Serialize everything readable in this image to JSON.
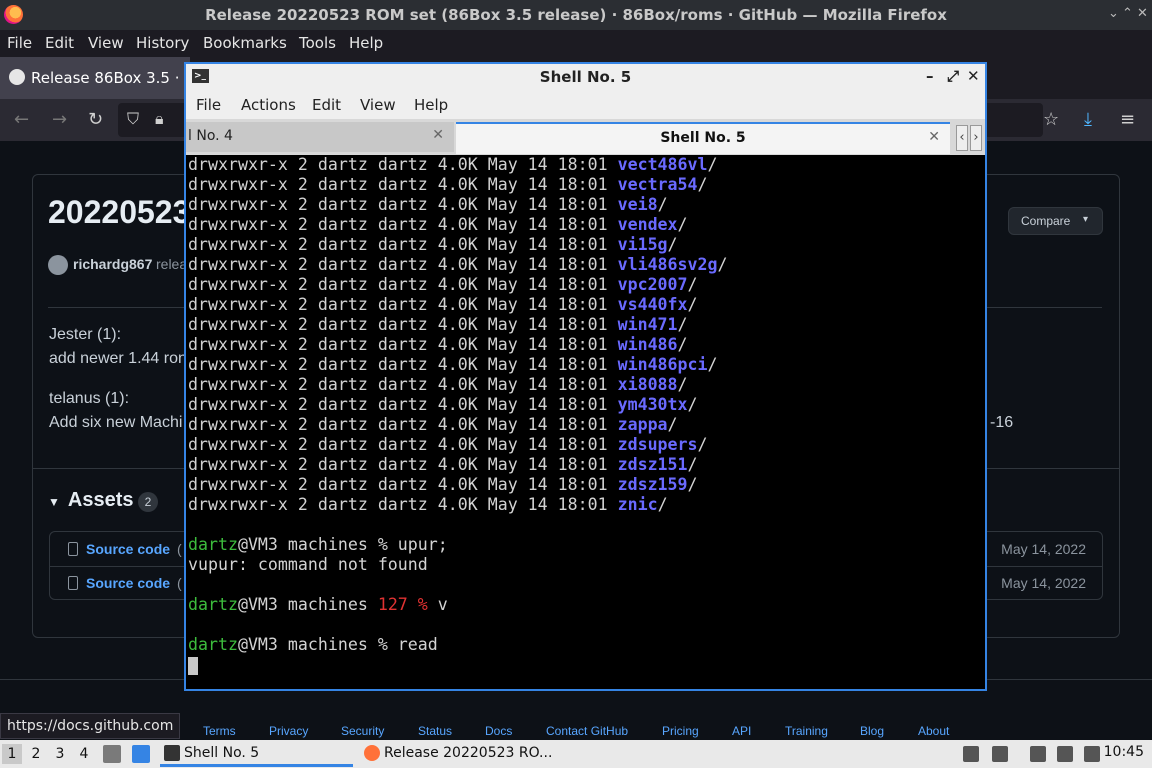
{
  "firefox": {
    "window_title": "Release 20220523 ROM set (86Box 3.5 release) · 86Box/roms · GitHub — Mozilla Firefox",
    "window_controls": [
      "⌄",
      "⌃",
      "✕"
    ],
    "menu": [
      "File",
      "Edit",
      "View",
      "History",
      "Bookmarks",
      "Tools",
      "Help"
    ],
    "tab_label": "Release 86Box 3.5 ·",
    "nav_icons": [
      "back-icon",
      "forward-icon",
      "reload-icon",
      "shield-icon",
      "lock-icon",
      "bookmark-star-icon",
      "download-icon",
      "menu-icon"
    ],
    "status_url": "https://docs.github.com"
  },
  "github": {
    "release_title": "20220523",
    "compare_label": "Compare",
    "author": "richardg867",
    "author_rest": "relea",
    "body": {
      "jester_name": "Jester (1):",
      "jester_text": "add newer 1.44 ron",
      "telanus_name": "telanus (1):",
      "telanus_text": "Add six new Machi",
      "telanus_tail": "-16"
    },
    "assets": {
      "title": "Assets",
      "count": "2",
      "items": [
        {
          "name": "Source code",
          "paren": "(",
          "date": "May 14, 2022"
        },
        {
          "name": "Source code",
          "paren": "(",
          "date": "May 14, 2022"
        }
      ]
    },
    "footer": [
      "Terms",
      "Privacy",
      "Security",
      "Status",
      "Docs",
      "Contact GitHub",
      "Pricing",
      "API",
      "Training",
      "Blog",
      "About"
    ]
  },
  "terminal": {
    "title": "Shell No. 5",
    "menu": [
      "File",
      "Actions",
      "Edit",
      "View",
      "Help"
    ],
    "tabs": [
      {
        "label": "l No. 4"
      },
      {
        "label": "Shell No. 5"
      }
    ],
    "listing_prefix": "drwxrwxr-x 2 dartz dartz 4.0K May 14 18:01 ",
    "dirs": [
      "vect486vl",
      "vectra54",
      "vei8",
      "vendex",
      "vi15g",
      "vli486sv2g",
      "vpc2007",
      "vs440fx",
      "win471",
      "win486",
      "win486pci",
      "xi8088",
      "ym430tx",
      "zappa",
      "zdsupers",
      "zdsz151",
      "zdsz159",
      "znic"
    ],
    "prompt_user": "dartz",
    "prompt_host": "@VM3 machines ",
    "cmd1": "% upur;",
    "err1": "vupur: command not found",
    "exit_code": "127 %",
    "cmd2": " v",
    "cmd3": "% read"
  },
  "taskbar": {
    "workspaces": [
      "1",
      "2",
      "3",
      "4"
    ],
    "shell_task": "Shell No. 5",
    "firefox_task": "Release 20220523 RO...",
    "clock": "10:45"
  }
}
